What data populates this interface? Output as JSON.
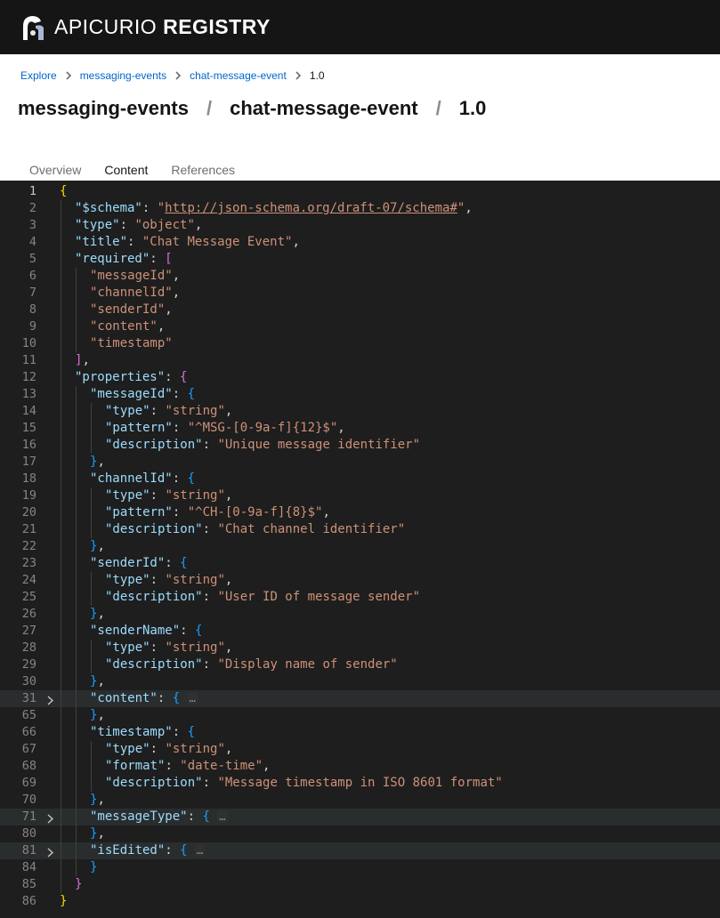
{
  "masthead": {
    "brand_light": "APICURIO",
    "brand_bold": "REGISTRY"
  },
  "breadcrumb": {
    "items": [
      "Explore",
      "messaging-events",
      "chat-message-event"
    ],
    "current": "1.0"
  },
  "title": {
    "group": "messaging-events",
    "separator": "/",
    "artifact": "chat-message-event",
    "version": "1.0"
  },
  "tabs": [
    {
      "label": "Overview",
      "active": false
    },
    {
      "label": "Content",
      "active": true
    },
    {
      "label": "References",
      "active": false
    }
  ],
  "colors": {
    "accent": "#0066cc",
    "masthead_bg": "#151515",
    "editor_bg": "#1e1e1e",
    "json_key": "#9cdcfe",
    "json_string": "#ce9178",
    "bracket_1": "#ffd700",
    "bracket_2": "#da70d6",
    "bracket_3": "#179fff"
  },
  "editor": {
    "language": "json",
    "current_line": 1,
    "lines": [
      {
        "n": "1",
        "i": 0,
        "t": [
          [
            "{",
            "b1"
          ]
        ]
      },
      {
        "n": "2",
        "i": 1,
        "t": [
          [
            "\"$schema\"",
            "k"
          ],
          [
            ": ",
            "p"
          ],
          [
            "\"",
            "s"
          ],
          [
            "http://json-schema.org/draft-07/schema#",
            "s u"
          ],
          [
            "\"",
            "s"
          ],
          [
            ",",
            "p"
          ]
        ]
      },
      {
        "n": "3",
        "i": 1,
        "t": [
          [
            "\"type\"",
            "k"
          ],
          [
            ": ",
            "p"
          ],
          [
            "\"object\"",
            "s"
          ],
          [
            ",",
            "p"
          ]
        ]
      },
      {
        "n": "4",
        "i": 1,
        "t": [
          [
            "\"title\"",
            "k"
          ],
          [
            ": ",
            "p"
          ],
          [
            "\"Chat Message Event\"",
            "s"
          ],
          [
            ",",
            "p"
          ]
        ]
      },
      {
        "n": "5",
        "i": 1,
        "t": [
          [
            "\"required\"",
            "k"
          ],
          [
            ": ",
            "p"
          ],
          [
            "[",
            "b2"
          ]
        ]
      },
      {
        "n": "6",
        "i": 2,
        "t": [
          [
            "\"messageId\"",
            "s"
          ],
          [
            ",",
            "p"
          ]
        ]
      },
      {
        "n": "7",
        "i": 2,
        "t": [
          [
            "\"channelId\"",
            "s"
          ],
          [
            ",",
            "p"
          ]
        ]
      },
      {
        "n": "8",
        "i": 2,
        "t": [
          [
            "\"senderId\"",
            "s"
          ],
          [
            ",",
            "p"
          ]
        ]
      },
      {
        "n": "9",
        "i": 2,
        "t": [
          [
            "\"content\"",
            "s"
          ],
          [
            ",",
            "p"
          ]
        ]
      },
      {
        "n": "10",
        "i": 2,
        "t": [
          [
            "\"timestamp\"",
            "s"
          ]
        ]
      },
      {
        "n": "11",
        "i": 1,
        "t": [
          [
            "]",
            "b2"
          ],
          [
            ",",
            "p"
          ]
        ]
      },
      {
        "n": "12",
        "i": 1,
        "t": [
          [
            "\"properties\"",
            "k"
          ],
          [
            ": ",
            "p"
          ],
          [
            "{",
            "b2"
          ]
        ]
      },
      {
        "n": "13",
        "i": 2,
        "t": [
          [
            "\"messageId\"",
            "k"
          ],
          [
            ": ",
            "p"
          ],
          [
            "{",
            "b3"
          ]
        ]
      },
      {
        "n": "14",
        "i": 3,
        "t": [
          [
            "\"type\"",
            "k"
          ],
          [
            ": ",
            "p"
          ],
          [
            "\"string\"",
            "s"
          ],
          [
            ",",
            "p"
          ]
        ]
      },
      {
        "n": "15",
        "i": 3,
        "t": [
          [
            "\"pattern\"",
            "k"
          ],
          [
            ": ",
            "p"
          ],
          [
            "\"^MSG-[0-9a-f]{12}$\"",
            "s"
          ],
          [
            ",",
            "p"
          ]
        ]
      },
      {
        "n": "16",
        "i": 3,
        "t": [
          [
            "\"description\"",
            "k"
          ],
          [
            ": ",
            "p"
          ],
          [
            "\"Unique message identifier\"",
            "s"
          ]
        ]
      },
      {
        "n": "17",
        "i": 2,
        "t": [
          [
            "}",
            "b3"
          ],
          [
            ",",
            "p"
          ]
        ]
      },
      {
        "n": "18",
        "i": 2,
        "t": [
          [
            "\"channelId\"",
            "k"
          ],
          [
            ": ",
            "p"
          ],
          [
            "{",
            "b3"
          ]
        ]
      },
      {
        "n": "19",
        "i": 3,
        "t": [
          [
            "\"type\"",
            "k"
          ],
          [
            ": ",
            "p"
          ],
          [
            "\"string\"",
            "s"
          ],
          [
            ",",
            "p"
          ]
        ]
      },
      {
        "n": "20",
        "i": 3,
        "t": [
          [
            "\"pattern\"",
            "k"
          ],
          [
            ": ",
            "p"
          ],
          [
            "\"^CH-[0-9a-f]{8}$\"",
            "s"
          ],
          [
            ",",
            "p"
          ]
        ]
      },
      {
        "n": "21",
        "i": 3,
        "t": [
          [
            "\"description\"",
            "k"
          ],
          [
            ": ",
            "p"
          ],
          [
            "\"Chat channel identifier\"",
            "s"
          ]
        ]
      },
      {
        "n": "22",
        "i": 2,
        "t": [
          [
            "}",
            "b3"
          ],
          [
            ",",
            "p"
          ]
        ]
      },
      {
        "n": "23",
        "i": 2,
        "t": [
          [
            "\"senderId\"",
            "k"
          ],
          [
            ": ",
            "p"
          ],
          [
            "{",
            "b3"
          ]
        ]
      },
      {
        "n": "24",
        "i": 3,
        "t": [
          [
            "\"type\"",
            "k"
          ],
          [
            ": ",
            "p"
          ],
          [
            "\"string\"",
            "s"
          ],
          [
            ",",
            "p"
          ]
        ]
      },
      {
        "n": "25",
        "i": 3,
        "t": [
          [
            "\"description\"",
            "k"
          ],
          [
            ": ",
            "p"
          ],
          [
            "\"User ID of message sender\"",
            "s"
          ]
        ]
      },
      {
        "n": "26",
        "i": 2,
        "t": [
          [
            "}",
            "b3"
          ],
          [
            ",",
            "p"
          ]
        ]
      },
      {
        "n": "27",
        "i": 2,
        "t": [
          [
            "\"senderName\"",
            "k"
          ],
          [
            ": ",
            "p"
          ],
          [
            "{",
            "b3"
          ]
        ]
      },
      {
        "n": "28",
        "i": 3,
        "t": [
          [
            "\"type\"",
            "k"
          ],
          [
            ": ",
            "p"
          ],
          [
            "\"string\"",
            "s"
          ],
          [
            ",",
            "p"
          ]
        ]
      },
      {
        "n": "29",
        "i": 3,
        "t": [
          [
            "\"description\"",
            "k"
          ],
          [
            ": ",
            "p"
          ],
          [
            "\"Display name of sender\"",
            "s"
          ]
        ]
      },
      {
        "n": "30",
        "i": 2,
        "t": [
          [
            "}",
            "b3"
          ],
          [
            ",",
            "p"
          ]
        ]
      },
      {
        "n": "31",
        "i": 2,
        "fold": true,
        "t": [
          [
            "\"content\"",
            "k"
          ],
          [
            ": ",
            "p"
          ],
          [
            "{",
            "b3"
          ]
        ]
      },
      {
        "n": "65",
        "i": 2,
        "t": [
          [
            "}",
            "b3"
          ],
          [
            ",",
            "p"
          ]
        ]
      },
      {
        "n": "66",
        "i": 2,
        "t": [
          [
            "\"timestamp\"",
            "k"
          ],
          [
            ": ",
            "p"
          ],
          [
            "{",
            "b3"
          ]
        ]
      },
      {
        "n": "67",
        "i": 3,
        "t": [
          [
            "\"type\"",
            "k"
          ],
          [
            ": ",
            "p"
          ],
          [
            "\"string\"",
            "s"
          ],
          [
            ",",
            "p"
          ]
        ]
      },
      {
        "n": "68",
        "i": 3,
        "t": [
          [
            "\"format\"",
            "k"
          ],
          [
            ": ",
            "p"
          ],
          [
            "\"date-time\"",
            "s"
          ],
          [
            ",",
            "p"
          ]
        ]
      },
      {
        "n": "69",
        "i": 3,
        "t": [
          [
            "\"description\"",
            "k"
          ],
          [
            ": ",
            "p"
          ],
          [
            "\"Message timestamp in ISO 8601 format\"",
            "s"
          ]
        ]
      },
      {
        "n": "70",
        "i": 2,
        "t": [
          [
            "}",
            "b3"
          ],
          [
            ",",
            "p"
          ]
        ]
      },
      {
        "n": "71",
        "i": 2,
        "fold": true,
        "t": [
          [
            "\"messageType\"",
            "k"
          ],
          [
            ": ",
            "p"
          ],
          [
            "{",
            "b3"
          ]
        ]
      },
      {
        "n": "80",
        "i": 2,
        "t": [
          [
            "}",
            "b3"
          ],
          [
            ",",
            "p"
          ]
        ]
      },
      {
        "n": "81",
        "i": 2,
        "fold": true,
        "t": [
          [
            "\"isEdited\"",
            "k"
          ],
          [
            ": ",
            "p"
          ],
          [
            "{",
            "b3"
          ]
        ]
      },
      {
        "n": "84",
        "i": 2,
        "t": [
          [
            "}",
            "b3"
          ]
        ]
      },
      {
        "n": "85",
        "i": 1,
        "t": [
          [
            "}",
            "b2"
          ]
        ]
      },
      {
        "n": "86",
        "i": 0,
        "t": [
          [
            "}",
            "b1"
          ]
        ]
      }
    ],
    "fold_ellipsis": "…"
  }
}
